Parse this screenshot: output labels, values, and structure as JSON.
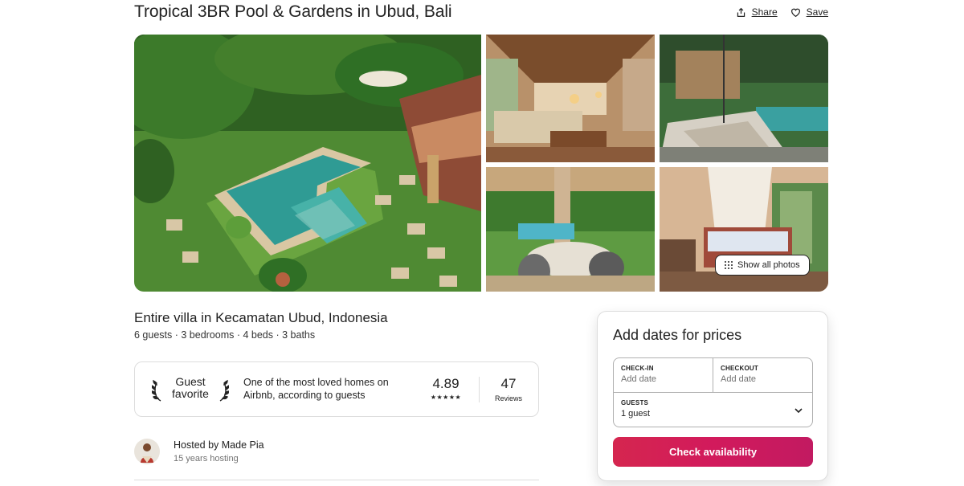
{
  "listing": {
    "title": "Tropical 3BR Pool & Gardens in Ubud, Bali",
    "subtitle": "Entire villa in Kecamatan Ubud, Indonesia",
    "details": "6 guests · 3 bedrooms · 4 beds · 3 baths"
  },
  "actions": {
    "share_label": "Share",
    "save_label": "Save",
    "share_icon": "share-icon",
    "save_icon": "heart-icon"
  },
  "gallery": {
    "show_all_label": "Show all photos",
    "photos": [
      {
        "name": "pool-garden-photo"
      },
      {
        "name": "living-room-photo"
      },
      {
        "name": "pool-lounger-photo"
      },
      {
        "name": "dining-terrace-photo"
      },
      {
        "name": "bedroom-photo"
      }
    ]
  },
  "guest_favorite": {
    "badge_line1": "Guest",
    "badge_line2": "favorite",
    "description": "One of the most loved homes on Airbnb, according to guests",
    "rating": "4.89",
    "stars": "★★★★★",
    "reviews_count": "47",
    "reviews_label": "Reviews"
  },
  "host": {
    "name": "Hosted by Made Pia",
    "years": "15 years hosting"
  },
  "booking": {
    "title": "Add dates for prices",
    "checkin_label": "CHECK-IN",
    "checkin_value": "Add date",
    "checkout_label": "CHECKOUT",
    "checkout_value": "Add date",
    "guests_label": "GUESTS",
    "guests_value": "1 guest",
    "button_label": "Check availability",
    "button_color": "#d21a5c"
  }
}
